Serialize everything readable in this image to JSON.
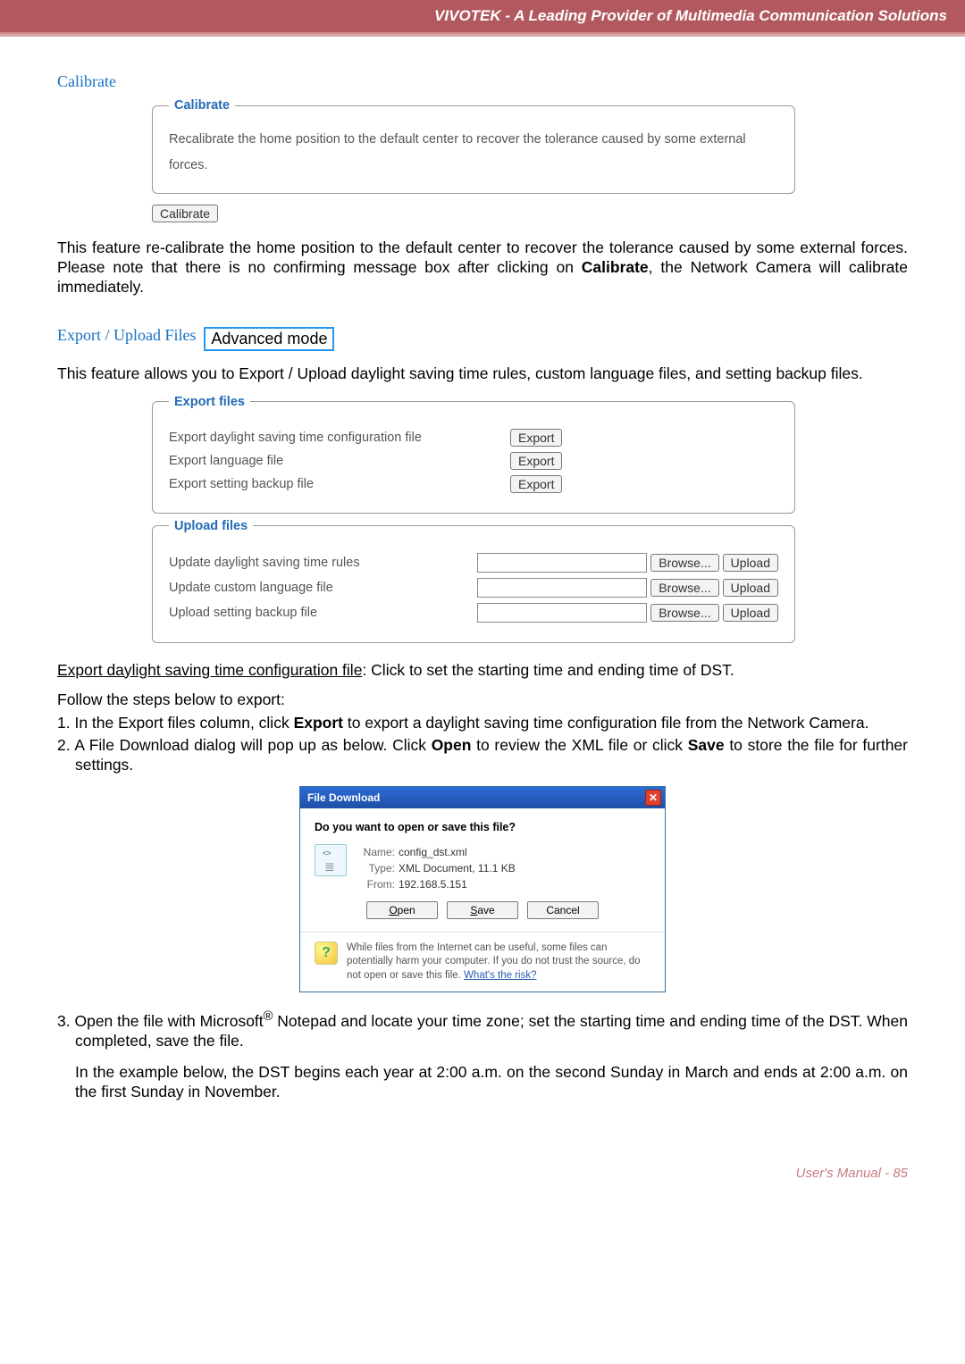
{
  "header": {
    "tagline": "VIVOTEK - A Leading Provider of Multimedia Communication Solutions"
  },
  "calibrate": {
    "heading": "Calibrate",
    "legend": "Calibrate",
    "desc": "Recalibrate the home position to the default center to recover the tolerance caused by some external forces.",
    "button": "Calibrate",
    "body": "This feature re-calibrate the home position to the default center to recover the tolerance caused by some external forces. Please note that there is no confirming message box after clicking on ",
    "body_bold": "Calibrate",
    "body_after": ", the Network Camera will calibrate immediately."
  },
  "export_upload": {
    "heading": "Export / Upload Files",
    "mode": "Advanced mode",
    "intro": "This feature allows you to Export / Upload daylight saving time rules, custom language files, and setting backup files.",
    "export_legend": "Export files",
    "upload_legend": "Upload files",
    "export_rows": [
      {
        "label": "Export daylight saving time configuration file",
        "btn": "Export"
      },
      {
        "label": "Export language file",
        "btn": "Export"
      },
      {
        "label": "Export setting backup file",
        "btn": "Export"
      }
    ],
    "upload_rows": [
      {
        "label": "Update daylight saving time rules",
        "browse": "Browse...",
        "upload": "Upload"
      },
      {
        "label": "Update custom language file",
        "browse": "Browse...",
        "upload": "Upload"
      },
      {
        "label": "Upload setting backup file",
        "browse": "Browse...",
        "upload": "Upload"
      }
    ]
  },
  "instructions": {
    "lead_underline": "Export daylight saving time configuration file",
    "lead_rest": ": Click to set the starting time and ending time of DST.",
    "follow": "Follow the steps below to export:",
    "step1_a": "1. In the Export files column, click ",
    "step1_b": "Export",
    "step1_c": " to export a daylight saving time configuration file from the Network Camera.",
    "step2_a": "2. A File Download dialog will pop up as below. Click ",
    "step2_b": "Open",
    "step2_c": " to review the XML file or click ",
    "step2_d": "Save",
    "step2_e": " to store the file for further settings.",
    "step3_a": "3. Open the file with Microsoft",
    "step3_reg": "®",
    "step3_b": " Notepad and locate your time zone; set the starting time and ending time of the DST. When completed, save the file.",
    "step3_para": "In the example below, the DST begins each year at 2:00 a.m. on the second Sunday in March and ends at 2:00 a.m. on the first Sunday in November."
  },
  "dialog": {
    "title": "File Download",
    "question": "Do you want to open or save this file?",
    "name_k": "Name:",
    "name_v": "config_dst.xml",
    "type_k": "Type:",
    "type_v": "XML Document, 11.1 KB",
    "from_k": "From:",
    "from_v": "192.168.5.151",
    "open": "Open",
    "open_u": "O",
    "save": "Save",
    "save_u": "S",
    "cancel": "Cancel",
    "warn": "While files from the Internet can be useful, some files can potentially harm your computer. If you do not trust the source, do not open or save this file. ",
    "warn_link": "What's the risk?"
  },
  "footer": {
    "label": "User's Manual - ",
    "page": "85"
  }
}
